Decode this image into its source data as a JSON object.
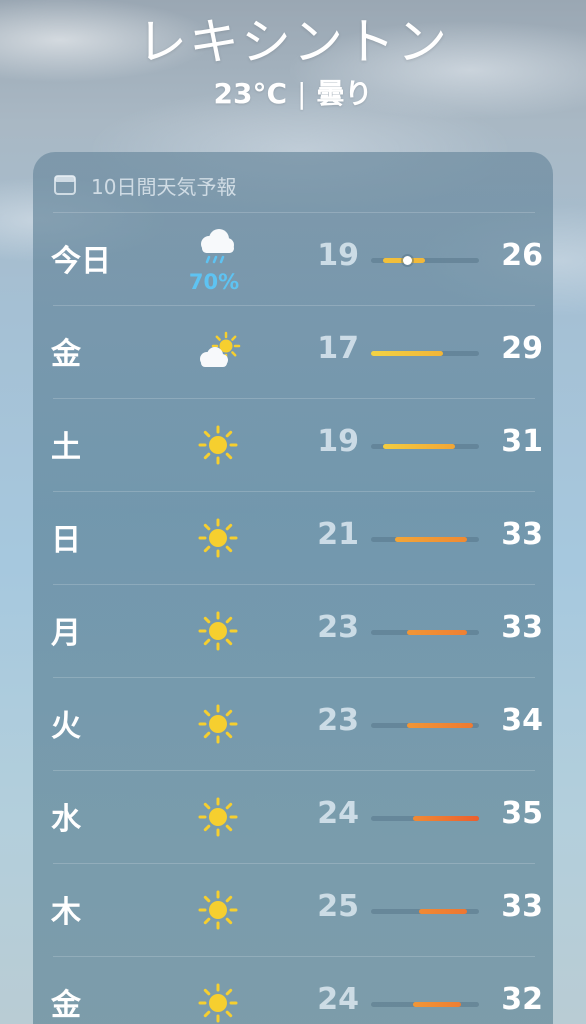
{
  "location": {
    "city": "レキシントン",
    "temperature": "23°C",
    "condition": "曇り"
  },
  "forecast": {
    "title": "10日間天気予報",
    "range_min": 17,
    "range_max": 35,
    "current_temp": 23,
    "days": [
      {
        "day": "今日",
        "icon": "rain-cloud-icon",
        "precip": "70%",
        "low": "19",
        "high": "26",
        "lo": 19,
        "hi": 26,
        "colors": [
          "#f2c13a",
          "#f2b83a"
        ],
        "show_current": true
      },
      {
        "day": "金",
        "icon": "partly-sunny-icon",
        "precip": "",
        "low": "17",
        "high": "29",
        "lo": 17,
        "hi": 29,
        "colors": [
          "#f3d344",
          "#f2b537"
        ],
        "show_current": false
      },
      {
        "day": "土",
        "icon": "sun-icon",
        "precip": "",
        "low": "19",
        "high": "31",
        "lo": 19,
        "hi": 31,
        "colors": [
          "#f3cd40",
          "#f1a535"
        ],
        "show_current": false
      },
      {
        "day": "日",
        "icon": "sun-icon",
        "precip": "",
        "low": "21",
        "high": "33",
        "lo": 21,
        "hi": 33,
        "colors": [
          "#f2a639",
          "#ef8a33"
        ],
        "show_current": false
      },
      {
        "day": "月",
        "icon": "sun-icon",
        "precip": "",
        "low": "23",
        "high": "33",
        "lo": 23,
        "hi": 33,
        "colors": [
          "#f19636",
          "#ef8033"
        ],
        "show_current": false
      },
      {
        "day": "火",
        "icon": "sun-icon",
        "precip": "",
        "low": "23",
        "high": "34",
        "lo": 23,
        "hi": 34,
        "colors": [
          "#f19636",
          "#ee7a32"
        ],
        "show_current": false
      },
      {
        "day": "水",
        "icon": "sun-icon",
        "precip": "",
        "low": "24",
        "high": "35",
        "lo": 24,
        "hi": 35,
        "colors": [
          "#f08a34",
          "#ec5f2e"
        ],
        "show_current": false
      },
      {
        "day": "木",
        "icon": "sun-icon",
        "precip": "",
        "low": "25",
        "high": "33",
        "lo": 25,
        "hi": 33,
        "colors": [
          "#f08a34",
          "#ee7632"
        ],
        "show_current": false
      },
      {
        "day": "金",
        "icon": "sun-icon",
        "precip": "",
        "low": "24",
        "high": "32",
        "lo": 24,
        "hi": 32,
        "colors": [
          "#f19636",
          "#ee7e33"
        ],
        "show_current": false
      }
    ]
  }
}
